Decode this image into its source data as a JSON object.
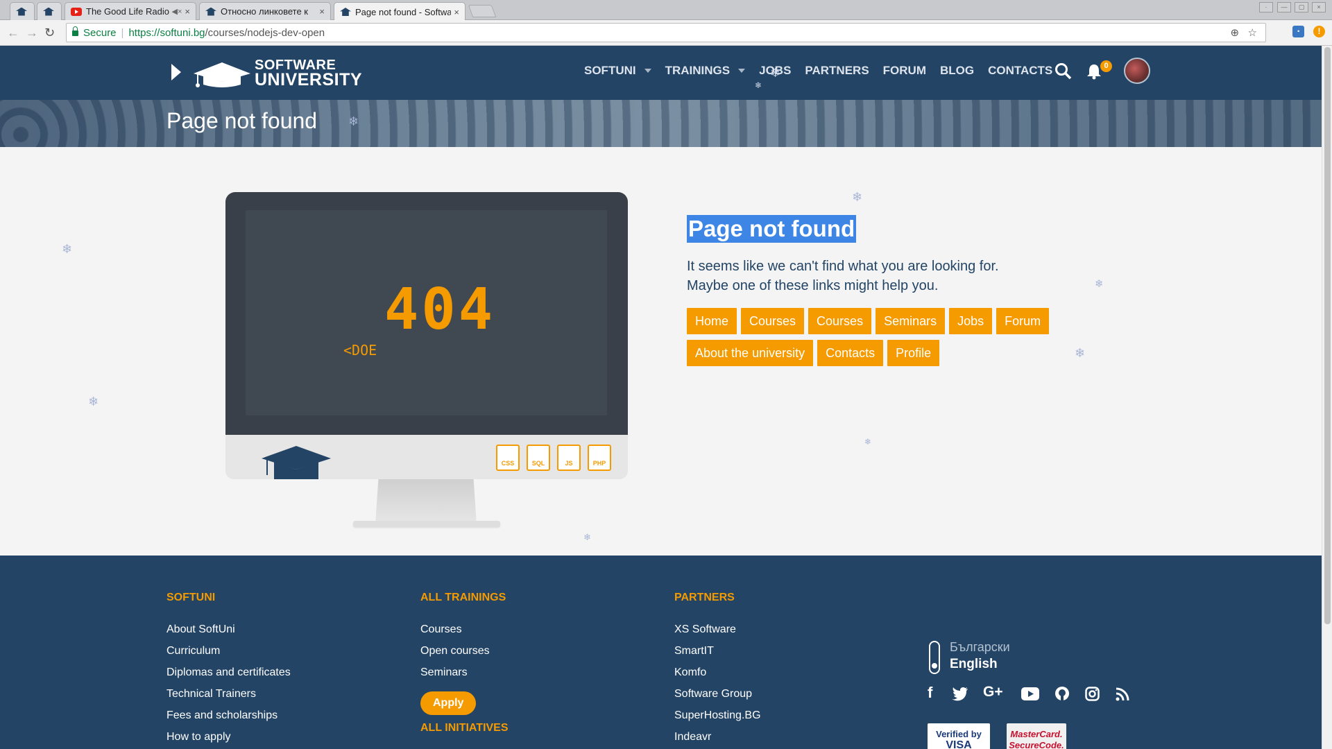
{
  "browser": {
    "tabs": [
      {
        "title": ""
      },
      {
        "title": ""
      },
      {
        "title": "The Good Life Radio"
      },
      {
        "title": "Относно линковете к"
      },
      {
        "title": "Page not found - Softwa"
      }
    ],
    "secure_label": "Secure",
    "url_host": "https://softuni.bg",
    "url_path": "/courses/nodejs-dev-open"
  },
  "header": {
    "logo_line1": "SOFTWARE",
    "logo_line2": "UNIVERSITY",
    "nav": [
      {
        "label": "SOFTUNI",
        "has_dropdown": true
      },
      {
        "label": "TRAININGS",
        "has_dropdown": true
      },
      {
        "label": "JOBS",
        "has_dropdown": false
      },
      {
        "label": "PARTNERS",
        "has_dropdown": false
      },
      {
        "label": "FORUM",
        "has_dropdown": false
      },
      {
        "label": "BLOG",
        "has_dropdown": false
      },
      {
        "label": "CONTACTS",
        "has_dropdown": false
      }
    ],
    "notification_count": "0"
  },
  "banner": {
    "title": "Page not found"
  },
  "illustration": {
    "code": "404",
    "caption": "<DOE",
    "file_icons": [
      "CSS",
      "SQL",
      "JS",
      "PHP"
    ]
  },
  "error": {
    "title": "Page not found",
    "line1": "It seems like we can't find what you are looking for.",
    "line2": "Maybe one of these links might help you.",
    "links": [
      "Home",
      "Courses",
      "Courses",
      "Seminars",
      "Jobs",
      "Forum",
      "About the university",
      "Contacts",
      "Profile"
    ]
  },
  "footer": {
    "col1": {
      "title": "SOFTUNI",
      "links": [
        "About SoftUni",
        "Curriculum",
        "Diplomas and certificates",
        "Technical Trainers",
        "Fees and scholarships",
        "How to apply"
      ]
    },
    "col2": {
      "title": "ALL TRAININGS",
      "links": [
        "Courses",
        "Open courses",
        "Seminars"
      ],
      "apply_label": "Apply",
      "next_heading": "ALL INITIATIVES"
    },
    "col3": {
      "title": "PARTNERS",
      "links": [
        "XS Software",
        "SmartIT",
        "Komfo",
        "Software Group",
        "SuperHosting.BG",
        "Indeavr"
      ]
    },
    "languages": {
      "bg": "Български",
      "en": "English"
    },
    "social_icons": [
      "facebook-icon",
      "twitter-icon",
      "google-plus-icon",
      "youtube-icon",
      "github-icon",
      "instagram-icon",
      "rss-icon"
    ],
    "payment_badges": [
      {
        "line1": "Verified by",
        "line2": "VISA"
      },
      {
        "line1": "MasterCard.",
        "line2": "SecureCode."
      }
    ]
  },
  "colors": {
    "brand_navy": "#234465",
    "accent_orange": "#f59b00",
    "selection_blue": "#3e86e5"
  }
}
